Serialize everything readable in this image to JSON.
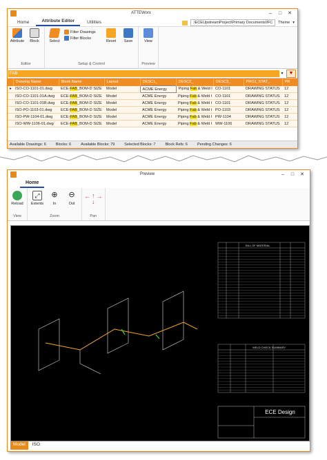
{
  "win1": {
    "title": "ATTEWorx",
    "tabs": [
      "Home",
      "Attribute Editor",
      "Utilities"
    ],
    "path": ".\\ECEUpstreamProject\\Primary Documents\\IFC",
    "theme": "Theme",
    "groups": {
      "editor": {
        "label": "Editor",
        "attribute": "Attribute",
        "block": "Block"
      },
      "setup": {
        "label": "Setup & Control",
        "select": "Select",
        "filter_drawings": "Filter Drawings",
        "filter_blocks": "Filter Blocks",
        "reset": "Reset",
        "save": "Save"
      },
      "preview": {
        "label": "Preview",
        "view": "View"
      }
    },
    "filter_value": "FAB",
    "table": {
      "headers": [
        "Drawing Name",
        "Block Name",
        "Layout",
        "DESC1_",
        "DESC2_",
        "DESC3_",
        "PROJ_STAT_",
        "PR"
      ],
      "rows": [
        [
          "ISO-CO-1101-01.dwg",
          "ECE-FAB_BOM-D SIZE",
          "Model",
          "ACME Energy",
          "Piping Fab & Weld I LineTag",
          "CO-1101",
          "DRAWING STATUS",
          "12"
        ],
        [
          "ISO-CO-1101-01A.dwg",
          "ECE-FAB_BOM-D SIZE",
          "Model",
          "ACME Energy",
          "Piping Fab & Weld I LineTag",
          "CO-1101",
          "DRAWING STATUS",
          "12"
        ],
        [
          "ISO-CO-1101-01B.dwg",
          "ECE-FAB_BOM-D SIZE",
          "Model",
          "ACME Energy",
          "Piping Fab & Weld I LineTag",
          "CO-1101",
          "DRAWING STATUS",
          "12"
        ],
        [
          "ISO-PO-1103-01.dwg",
          "ECE-FAB_BOM-D SIZE",
          "Model",
          "ACME Energy",
          "Piping Fab & Weld I LineTag",
          "PO-1103",
          "DRAWING STATUS",
          "12"
        ],
        [
          "ISO-PW-1104-01.dwg",
          "ECE-FAB_BOM-D SIZE",
          "Model",
          "ACME Energy",
          "Piping Fab & Weld I LineTag",
          "PW-1104",
          "DRAWING STATUS",
          "12"
        ],
        [
          "ISO-WW-1106-01.dwg",
          "ECE-FAB_BOM-D SIZE",
          "Model",
          "ACME Energy",
          "Piping Fab & Weld I LineTag",
          "WW-1106",
          "DRAWING STATUS",
          "12"
        ]
      ]
    },
    "status": {
      "available_drawings": "Available Drawings: 6",
      "blocks": "Blocks: 6",
      "available_blocks": "Available Blocks: 79",
      "selected_blocks": "Selected Blocks: 7",
      "block_refs": "Block Refs: 6",
      "pending_changes": "Pending Changes: 6"
    }
  },
  "win2": {
    "title": "Preview",
    "tab": "Home",
    "groups": {
      "view": {
        "label": "View",
        "reload": "Reload"
      },
      "zoom": {
        "label": "Zoom",
        "extents": "Extents",
        "in": "In",
        "out": "Out"
      },
      "pan": {
        "label": "Pan"
      }
    },
    "drawing": {
      "bom_title": "BILL OF MATERIAL",
      "weld_title": "WELD CHECK SUMMARY",
      "company": "ECE Design"
    },
    "bottom_tabs": [
      "Model",
      "ISO"
    ]
  },
  "colors": {
    "accent": "#e88a1a",
    "header": "#f08c22",
    "highlight": "#ffe600"
  }
}
